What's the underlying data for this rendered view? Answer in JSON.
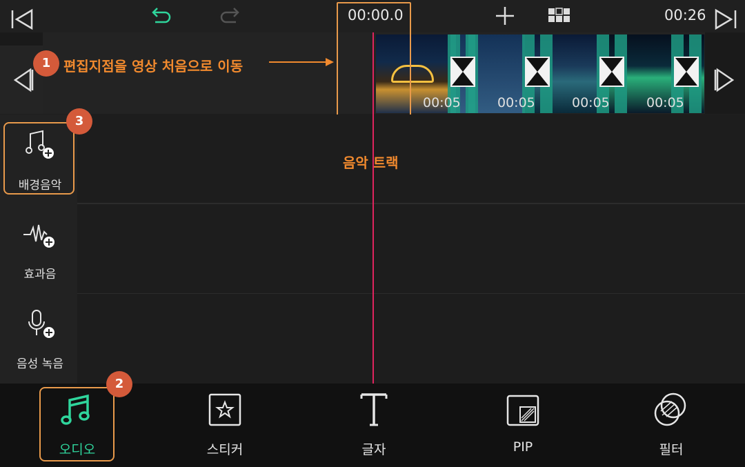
{
  "topbar": {
    "current_time": "00:00.0",
    "total_time": "00:26"
  },
  "timeline": {
    "clips": [
      {
        "duration": "00:05"
      },
      {
        "duration": "00:05"
      },
      {
        "duration": "00:05"
      },
      {
        "duration": "00:05"
      }
    ]
  },
  "annotations": {
    "badge1": "1",
    "badge2": "2",
    "badge3": "3",
    "callout1": "편집지점을 영상 처음으로 이동",
    "music_track": "음악 트랙"
  },
  "sidebar": {
    "items": [
      {
        "label": "배경음악",
        "icon": "music-note-add-icon"
      },
      {
        "label": "효과음",
        "icon": "waveform-add-icon"
      },
      {
        "label": "음성 녹음",
        "icon": "microphone-add-icon"
      }
    ]
  },
  "bottombar": {
    "tabs": [
      {
        "label": "오디오",
        "icon": "music-note-icon",
        "active": true
      },
      {
        "label": "스티커",
        "icon": "sticker-icon"
      },
      {
        "label": "글자",
        "icon": "text-icon"
      },
      {
        "label": "PIP",
        "icon": "pip-icon"
      },
      {
        "label": "필터",
        "icon": "filter-icon"
      }
    ]
  },
  "colors": {
    "accent": "#2fd59c",
    "playhead": "#e0245e",
    "annotation": "#f28a2e",
    "badge": "#d45a3a"
  }
}
